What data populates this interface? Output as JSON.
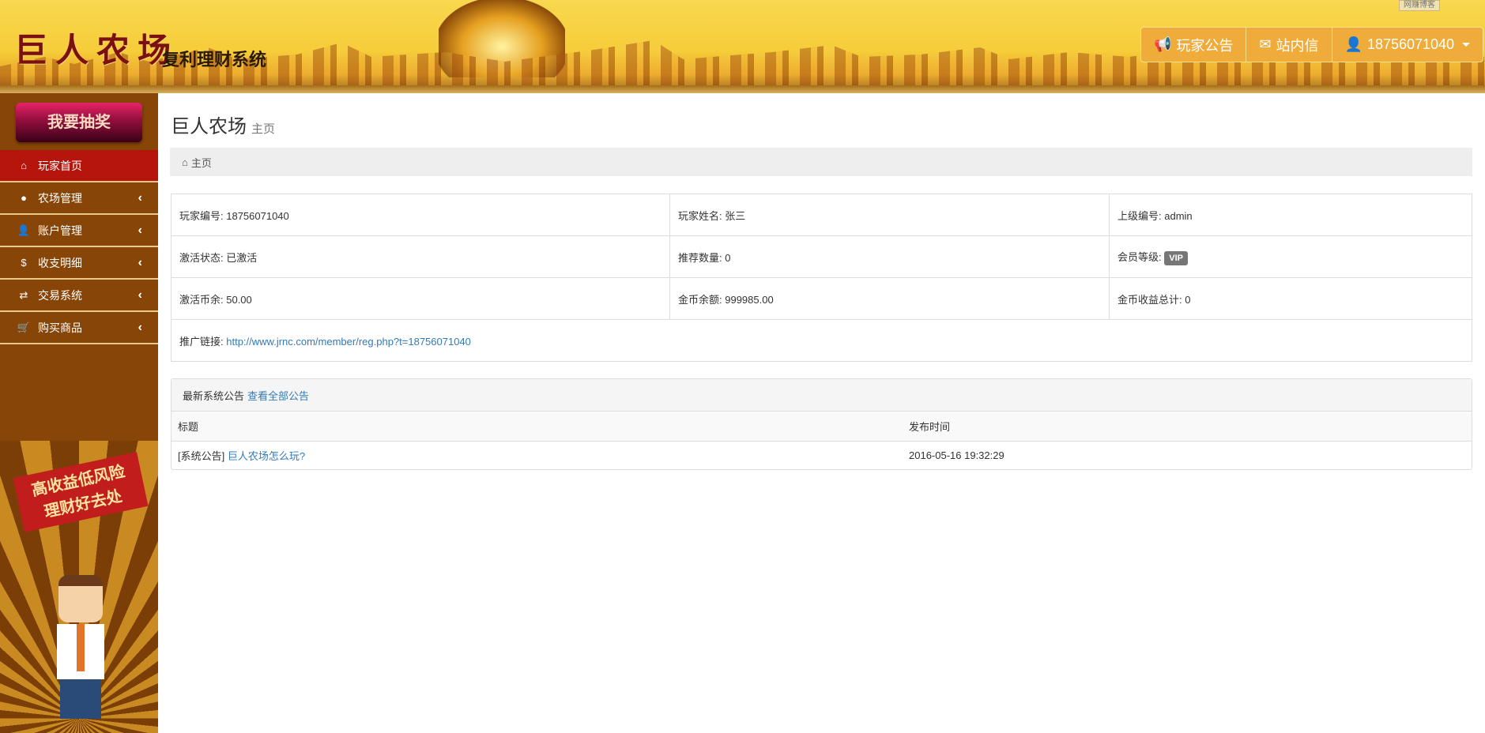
{
  "header": {
    "logo": "巨人农场",
    "subtitle": "复利理财系统",
    "watermark": "网赚博客",
    "nav": [
      {
        "icon": "bullhorn-icon",
        "label": "玩家公告"
      },
      {
        "icon": "envelope-icon",
        "label": "站内信"
      },
      {
        "icon": "user-icon",
        "label": "18756071040"
      }
    ]
  },
  "sidebar": {
    "lottery": "我要抽奖",
    "items": [
      {
        "label": "玩家首页",
        "icon": "home-icon",
        "active": true
      },
      {
        "label": "农场管理",
        "icon": "piggy-bank-icon"
      },
      {
        "label": "账户管理",
        "icon": "user-icon"
      },
      {
        "label": "收支明细",
        "icon": "dollar-icon"
      },
      {
        "label": "交易系统",
        "icon": "retweet-icon"
      },
      {
        "label": "购买商品",
        "icon": "cart-icon"
      }
    ],
    "promo": {
      "line1": "高收益低风险",
      "line2": "理财好去处"
    }
  },
  "page": {
    "title": "巨人农场",
    "subtitle": "主页",
    "breadcrumb": "主页"
  },
  "info": {
    "player_id_label": "玩家编号: ",
    "player_id": "18756071040",
    "name_label": "玩家姓名: ",
    "name": "张三",
    "parent_label": "上级编号: ",
    "parent": "admin",
    "status_label": "激活状态: ",
    "status": "已激活",
    "referrals_label": "推荐数量: ",
    "referrals": "0",
    "level_label": "会员等级: ",
    "level": "VIP",
    "activation_label": "激活币余: ",
    "activation": "50.00",
    "gold_label": "金币余额: ",
    "gold": "999985.00",
    "earnings_label": "金币收益总计: ",
    "earnings": "0",
    "link_label": "推广链接: ",
    "link": "http://www.jrnc.com/member/reg.php?t=18756071040"
  },
  "announcements": {
    "heading": "最新系统公告",
    "view_all": "查看全部公告",
    "col_title": "标题",
    "col_time": "发布时间",
    "rows": [
      {
        "tag": "[系统公告]",
        "title": "巨人农场怎么玩?",
        "time": "2016-05-16 19:32:29"
      }
    ]
  }
}
